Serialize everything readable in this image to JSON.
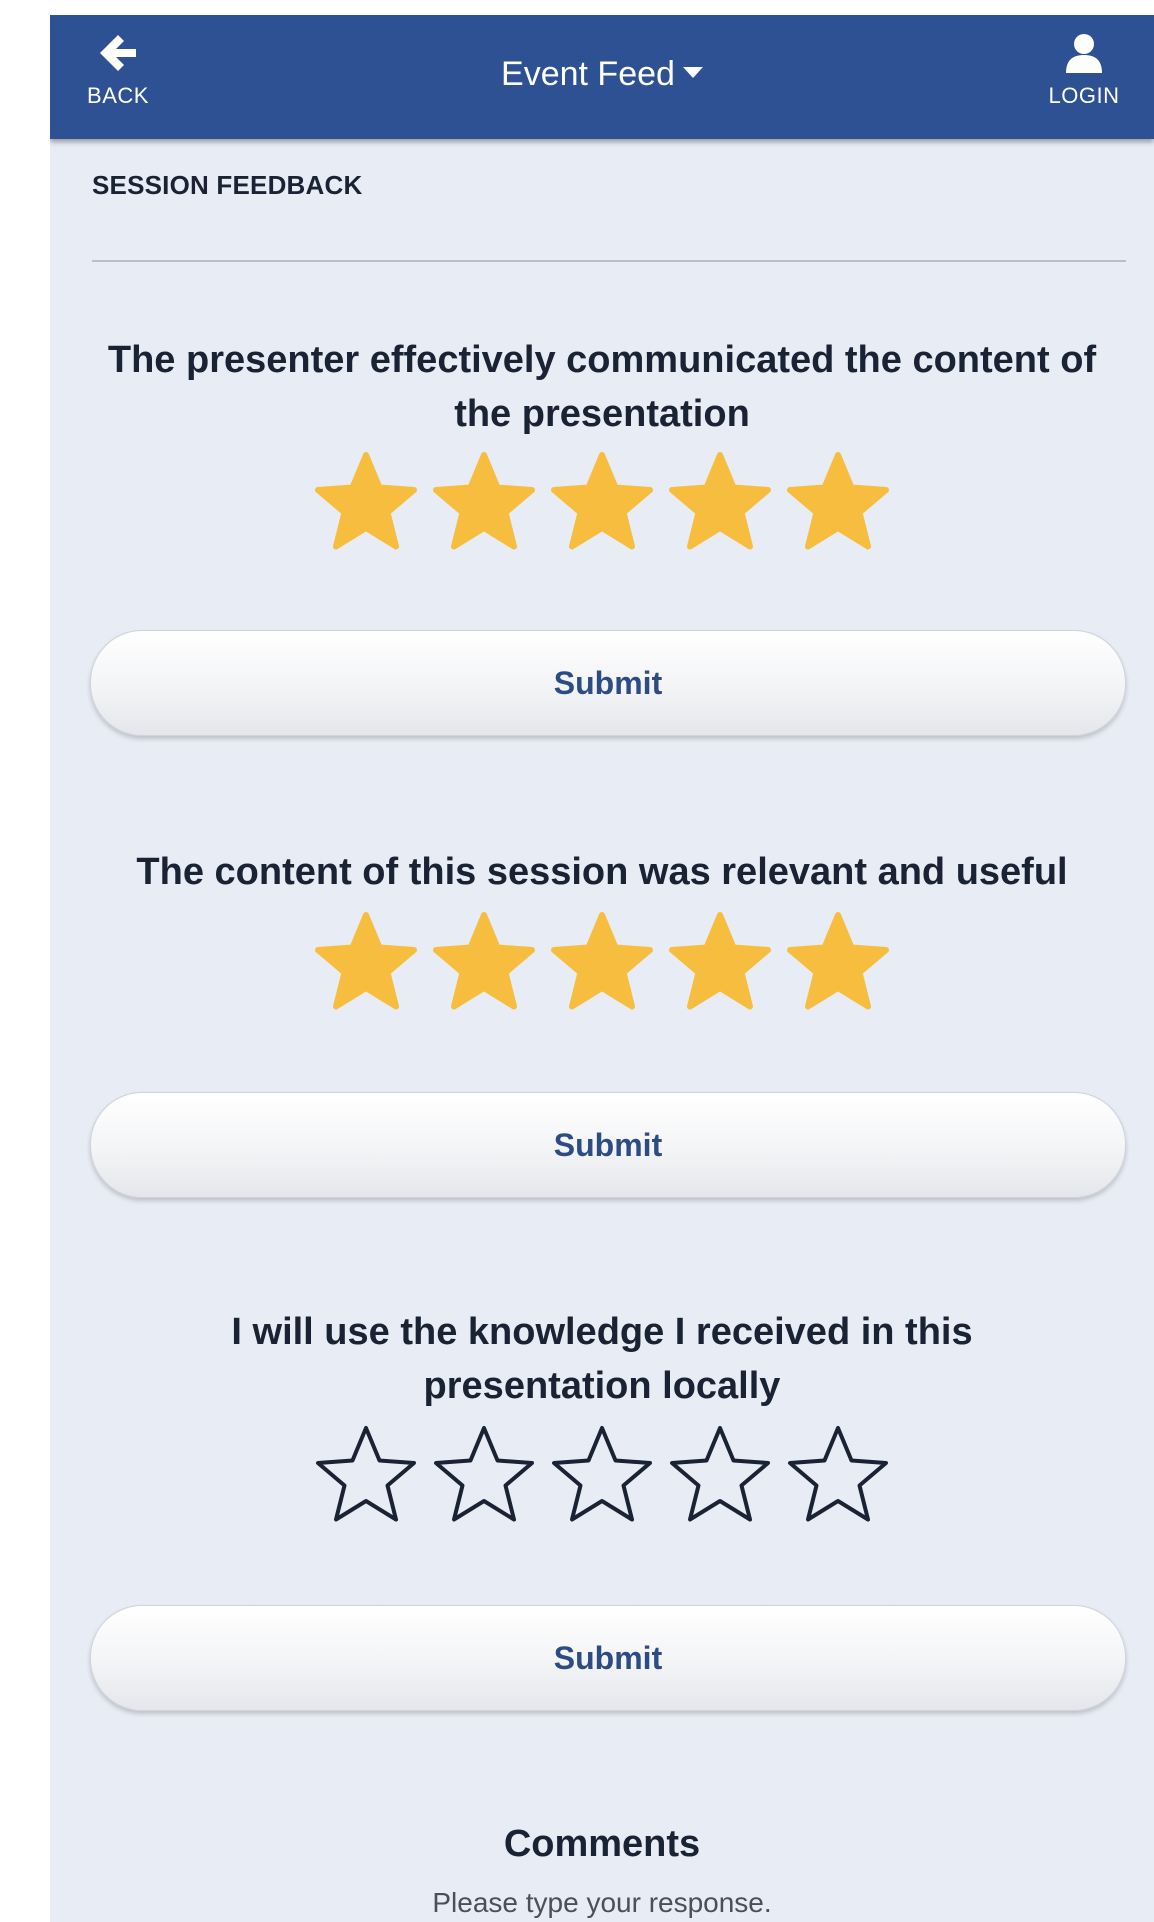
{
  "header": {
    "back_label": "BACK",
    "back_icon": "arrow-left-icon",
    "title": "Event Feed",
    "title_icon": "caret-down-icon",
    "login_label": "LOGIN",
    "login_icon": "user-icon",
    "bar_color": "#2d5192"
  },
  "section": {
    "title": "SESSION FEEDBACK"
  },
  "questions": [
    {
      "text": "The presenter effectively communicated the content of the presentation",
      "rating": 5,
      "max_rating": 5,
      "submit_label": "Submit"
    },
    {
      "text": "The content of this session was relevant and useful",
      "rating": 5,
      "max_rating": 5,
      "submit_label": "Submit"
    },
    {
      "text": "I will use the knowledge I received in this presentation locally",
      "rating": 0,
      "max_rating": 5,
      "submit_label": "Submit"
    }
  ],
  "comments": {
    "title": "Comments",
    "placeholder": "Please type your response."
  },
  "colors": {
    "star_filled": "#f7bd3f",
    "star_empty_outline": "#1a2334",
    "background": "#e8ecf4",
    "submit_text": "#2d4c84"
  }
}
